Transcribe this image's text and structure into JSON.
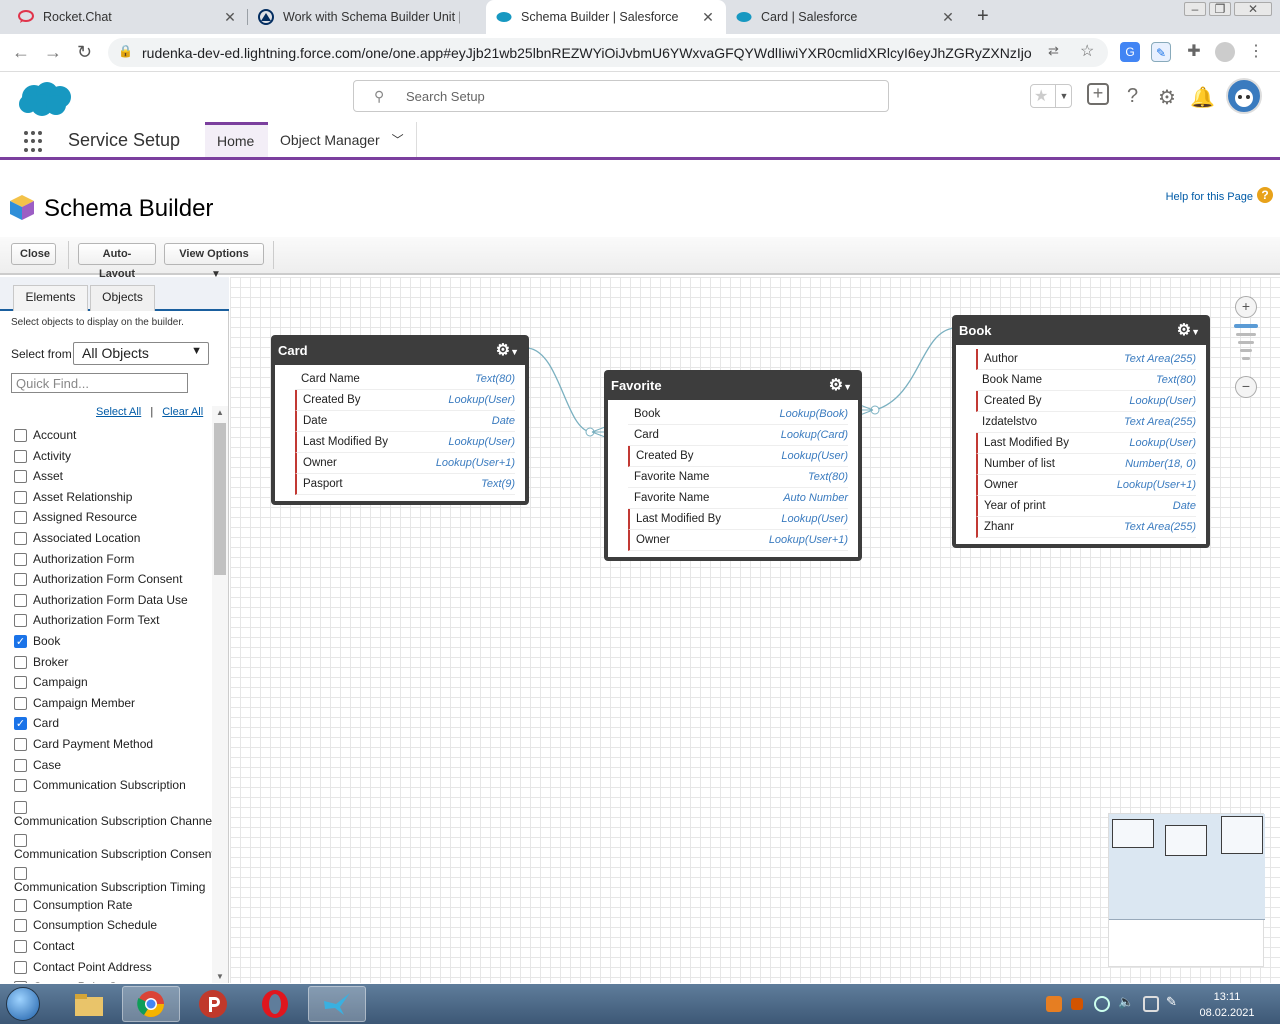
{
  "browser": {
    "tabs": [
      {
        "title": "Rocket.Chat",
        "icon": "rocketchat-icon",
        "active": false
      },
      {
        "title": "Work with Schema Builder Unit |",
        "icon": "trailhead-icon",
        "active": false
      },
      {
        "title": "Schema Builder | Salesforce",
        "icon": "salesforce-cloud-icon",
        "active": true
      },
      {
        "title": "Card | Salesforce",
        "icon": "salesforce-cloud-icon",
        "active": false
      }
    ],
    "close_glyph": "✕",
    "new_tab_glyph": "+",
    "url": "rudenka-dev-ed.lightning.force.com/one/one.app#eyJjb21wb25lbnREZWYiOiJvbmU6YWxvaGFQYWdlIiwiYXR0cmlidXRlcyI6eyJhZGRyZXNzIjoiL1..."
  },
  "sf": {
    "brand_color": "#1798c1",
    "search_placeholder": "Search Setup",
    "app_name": "Service Setup",
    "nav": {
      "home": "Home",
      "object_manager": "Object Manager"
    }
  },
  "page": {
    "title": "Schema Builder",
    "help_link": "Help for this Page",
    "buttons": {
      "close": "Close",
      "auto_layout": "Auto-Layout",
      "view_options": "View Options"
    }
  },
  "sidebar": {
    "tabs": {
      "elements": "Elements",
      "objects": "Objects"
    },
    "help_text": "Select objects to display on the builder.",
    "select_from_label": "Select from",
    "select_from_value": "All Objects",
    "quick_find_placeholder": "Quick Find...",
    "select_all": "Select All",
    "separator": "|",
    "clear_all": "Clear All",
    "objects": [
      {
        "name": "Account",
        "checked": false
      },
      {
        "name": "Activity",
        "checked": false
      },
      {
        "name": "Asset",
        "checked": false
      },
      {
        "name": "Asset Relationship",
        "checked": false
      },
      {
        "name": "Assigned Resource",
        "checked": false
      },
      {
        "name": "Associated Location",
        "checked": false
      },
      {
        "name": "Authorization Form",
        "checked": false
      },
      {
        "name": "Authorization Form Consent",
        "checked": false
      },
      {
        "name": "Authorization Form Data Use",
        "checked": false
      },
      {
        "name": "Authorization Form Text",
        "checked": false
      },
      {
        "name": "Book",
        "checked": true
      },
      {
        "name": "Broker",
        "checked": false
      },
      {
        "name": "Campaign",
        "checked": false
      },
      {
        "name": "Campaign Member",
        "checked": false
      },
      {
        "name": "Card",
        "checked": true
      },
      {
        "name": "Card Payment Method",
        "checked": false
      },
      {
        "name": "Case",
        "checked": false
      },
      {
        "name": "Communication Subscription",
        "checked": false
      },
      {
        "name": "Communication Subscription Channel T",
        "checked": false
      },
      {
        "name": "Communication Subscription Consent",
        "checked": false
      },
      {
        "name": "Communication Subscription Timing",
        "checked": false
      },
      {
        "name": "Consumption Rate",
        "checked": false
      },
      {
        "name": "Consumption Schedule",
        "checked": false
      },
      {
        "name": "Contact",
        "checked": false
      },
      {
        "name": "Contact Point Address",
        "checked": false
      },
      {
        "name": "Contact Point Consent",
        "checked": false
      }
    ]
  },
  "schema": {
    "card": {
      "title": "Card",
      "fields": [
        {
          "name": "Card Name",
          "type": "Text(80)",
          "required": false
        },
        {
          "name": "Created By",
          "type": "Lookup(User)",
          "required": true
        },
        {
          "name": "Date",
          "type": "Date",
          "required": true
        },
        {
          "name": "Last Modified By",
          "type": "Lookup(User)",
          "required": true
        },
        {
          "name": "Owner",
          "type": "Lookup(User+1)",
          "required": true
        },
        {
          "name": "Pasport",
          "type": "Text(9)",
          "required": true
        }
      ]
    },
    "favorite": {
      "title": "Favorite",
      "fields": [
        {
          "name": "Book",
          "type": "Lookup(Book)",
          "required": false
        },
        {
          "name": "Card",
          "type": "Lookup(Card)",
          "required": false
        },
        {
          "name": "Created By",
          "type": "Lookup(User)",
          "required": true
        },
        {
          "name": "Favorite Name",
          "type": "Text(80)",
          "required": false
        },
        {
          "name": "Favorite Name",
          "type": "Auto Number",
          "required": false
        },
        {
          "name": "Last Modified By",
          "type": "Lookup(User)",
          "required": true
        },
        {
          "name": "Owner",
          "type": "Lookup(User+1)",
          "required": true
        }
      ]
    },
    "book": {
      "title": "Book",
      "fields": [
        {
          "name": "Author",
          "type": "Text Area(255)",
          "required": true
        },
        {
          "name": "Book Name",
          "type": "Text(80)",
          "required": false
        },
        {
          "name": "Created By",
          "type": "Lookup(User)",
          "required": true
        },
        {
          "name": "Izdatelstvo",
          "type": "Text Area(255)",
          "required": false
        },
        {
          "name": "Last Modified By",
          "type": "Lookup(User)",
          "required": true
        },
        {
          "name": "Number of list",
          "type": "Number(18, 0)",
          "required": true
        },
        {
          "name": "Owner",
          "type": "Lookup(User+1)",
          "required": true
        },
        {
          "name": "Year of print",
          "type": "Date",
          "required": true
        },
        {
          "name": "Zhanr",
          "type": "Text Area(255)",
          "required": true
        }
      ]
    }
  },
  "taskbar": {
    "time": "13:11",
    "date": "08.02.2021"
  }
}
